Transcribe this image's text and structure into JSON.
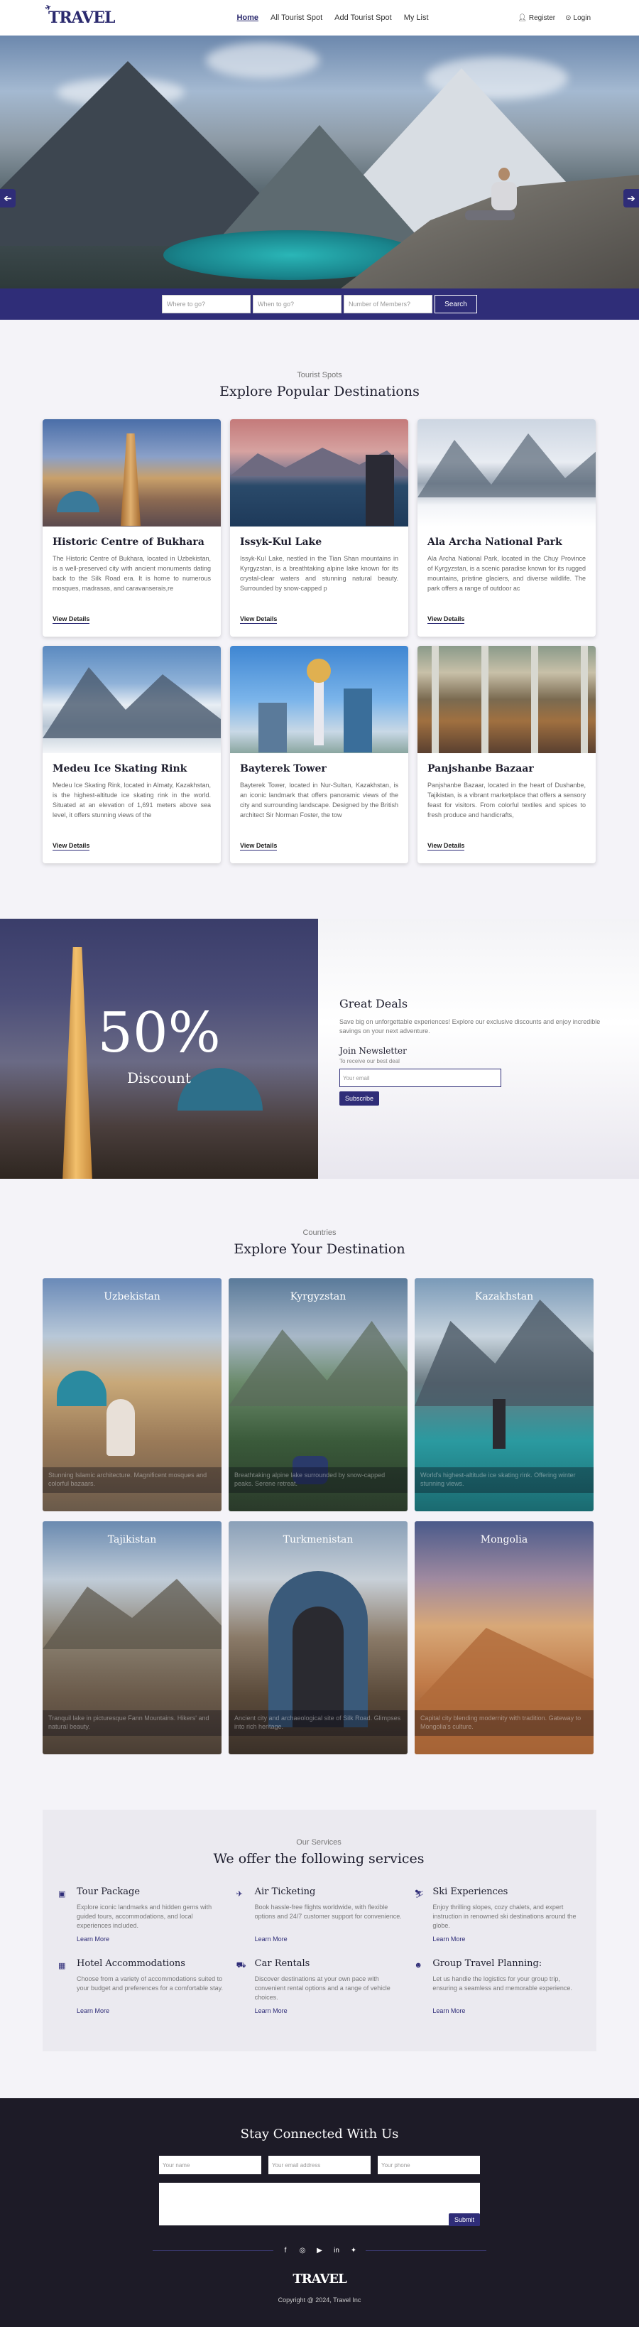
{
  "brand": {
    "logo": "TRAVEL",
    "footer_logo": "TRAVEL"
  },
  "nav": {
    "links": [
      "Home",
      "All Tourist Spot",
      "Add Tourist Spot",
      "My List"
    ],
    "register": "Register",
    "login": "Login"
  },
  "search": {
    "where_placeholder": "Where to go?",
    "when_placeholder": "When to go?",
    "members_placeholder": "Number of Members?",
    "button": "Search"
  },
  "spots": {
    "kicker": "Tourist Spots",
    "title": "Explore Popular Destinations",
    "view_label": "View Details",
    "items": [
      {
        "name": "Historic Centre of Bukhara",
        "desc": "The Historic Centre of Bukhara, located in Uzbekistan, is a well-preserved city with ancient monuments dating back to the Silk Road era. It is home to numerous mosques, madrasas, and caravanserais,re"
      },
      {
        "name": "Issyk-Kul Lake",
        "desc": "Issyk-Kul Lake, nestled in the Tian Shan mountains in Kyrgyzstan, is a breathtaking alpine lake known for its crystal-clear waters and stunning natural beauty. Surrounded by snow-capped p"
      },
      {
        "name": "Ala Archa National Park",
        "desc": "Ala Archa National Park, located in the Chuy Province of Kyrgyzstan, is a scenic paradise known for its rugged mountains, pristine glaciers, and diverse wildlife. The park offers a range of outdoor ac"
      },
      {
        "name": "Medeu Ice Skating Rink",
        "desc": "Medeu Ice Skating Rink, located in Almaty, Kazakhstan, is the highest-altitude ice skating rink in the world. Situated at an elevation of 1,691 meters above sea level, it offers stunning views of the"
      },
      {
        "name": "Bayterek Tower",
        "desc": "Bayterek Tower, located in Nur-Sultan, Kazakhstan, is an iconic landmark that offers panoramic views of the city and surrounding landscape. Designed by the British architect Sir Norman Foster, the tow"
      },
      {
        "name": "Panjshanbe Bazaar",
        "desc": "Panjshanbe Bazaar, located in the heart of Dushanbe, Tajikistan, is a vibrant marketplace that offers a sensory feast for visitors. From colorful textiles and spices to fresh produce and handicrafts,"
      }
    ]
  },
  "deal": {
    "percent": "50%",
    "discount": "Discount",
    "title": "Great Deals",
    "lead": "Save big on unforgettable experiences! Explore our exclusive discounts and enjoy incredible savings on your next adventure.",
    "newsletter": "Join Newsletter",
    "newsletter_sub": "To receive our best deal",
    "email_placeholder": "Your email",
    "subscribe": "Subscribe"
  },
  "countries": {
    "kicker": "Countries",
    "title": "Explore Your Destination",
    "items": [
      {
        "name": "Uzbekistan",
        "desc": "Stunning Islamic architecture. Magnificent mosques and colorful bazaars."
      },
      {
        "name": "Kyrgyzstan",
        "desc": "Breathtaking alpine lake surrounded by snow-capped peaks. Serene retreat."
      },
      {
        "name": "Kazakhstan",
        "desc": "World's highest-altitude ice skating rink. Offering winter stunning views."
      },
      {
        "name": "Tajikistan",
        "desc": "Tranquil lake in picturesque Fann Mountains. Hikers' and natural beauty."
      },
      {
        "name": "Turkmenistan",
        "desc": "Ancient city and archaeological site of Silk Road. Glimpses into rich heritage."
      },
      {
        "name": "Mongolia",
        "desc": "Capital city blending modernity with tradition. Gateway to Mongolia's culture."
      }
    ]
  },
  "services": {
    "kicker": "Our Services",
    "title": "We offer the following services",
    "learn": "Learn More",
    "items": [
      {
        "icon": "suitcase-icon",
        "glyph": "▣",
        "name": "Tour Package",
        "desc": "Explore iconic landmarks and hidden gems with guided tours, accommodations, and local experiences included."
      },
      {
        "icon": "ticket-icon",
        "glyph": "✈",
        "name": "Air Ticketing",
        "desc": "Book hassle-free flights worldwide, with flexible options and 24/7 customer support for convenience."
      },
      {
        "icon": "ski-icon",
        "glyph": "⛷",
        "name": "Ski Experiences",
        "desc": "Enjoy thrilling slopes, cozy chalets, and expert instruction in renowned ski destinations around the globe."
      },
      {
        "icon": "hotel-icon",
        "glyph": "▦",
        "name": "Hotel Accommodations",
        "desc": "Choose from a variety of accommodations suited to your budget and preferences for a comfortable stay."
      },
      {
        "icon": "car-icon",
        "glyph": "⛟",
        "name": "Car Rentals",
        "desc": "Discover destinations at your own pace with convenient rental options and a range of vehicle choices."
      },
      {
        "icon": "group-icon",
        "glyph": "☻",
        "name": "Group Travel Planning:",
        "desc": "Let us handle the logistics for your group trip, ensuring a seamless and memorable experience."
      }
    ]
  },
  "footer": {
    "title": "Stay Connected With Us",
    "name_placeholder": "Your name",
    "email_placeholder": "Your email address",
    "phone_placeholder": "Your phone",
    "submit": "Submit",
    "copyright": "Copyright @ 2024, Travel Inc"
  },
  "colors": {
    "accent": "#2f2d78",
    "footer_bg": "#1d1b27",
    "page_bg": "#f4f3f8"
  }
}
